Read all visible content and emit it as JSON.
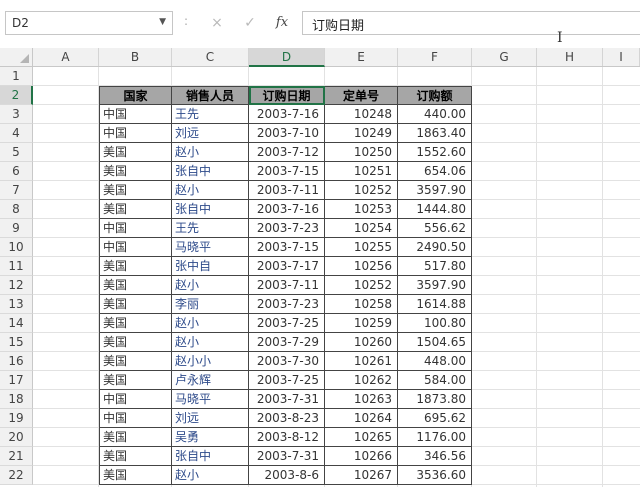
{
  "formula_bar": {
    "name_box": "D2",
    "separator": ":",
    "cancel_icon": "×",
    "enter_icon": "✓",
    "fx_label": "fx",
    "content": "订购日期"
  },
  "cursor": "I",
  "columns": [
    "A",
    "B",
    "C",
    "D",
    "E",
    "F",
    "G",
    "H",
    "I"
  ],
  "rows": [
    "1",
    "2",
    "3",
    "4",
    "5",
    "6",
    "7",
    "8",
    "9",
    "10",
    "11",
    "12",
    "13",
    "14",
    "15",
    "16",
    "17",
    "18",
    "19",
    "20",
    "21",
    "22"
  ],
  "table": {
    "headers": [
      "国家",
      "销售人员",
      "订购日期",
      "定单号",
      "订购额"
    ],
    "rows": [
      [
        "中国",
        "王先",
        "2003-7-16",
        "10248",
        "440.00"
      ],
      [
        "中国",
        "刘远",
        "2003-7-10",
        "10249",
        "1863.40"
      ],
      [
        "美国",
        "赵小",
        "2003-7-12",
        "10250",
        "1552.60"
      ],
      [
        "美国",
        "张自中",
        "2003-7-15",
        "10251",
        "654.06"
      ],
      [
        "美国",
        "赵小",
        "2003-7-11",
        "10252",
        "3597.90"
      ],
      [
        "美国",
        "张自中",
        "2003-7-16",
        "10253",
        "1444.80"
      ],
      [
        "中国",
        "王先",
        "2003-7-23",
        "10254",
        "556.62"
      ],
      [
        "中国",
        "马晓平",
        "2003-7-15",
        "10255",
        "2490.50"
      ],
      [
        "美国",
        "张中自",
        "2003-7-17",
        "10256",
        "517.80"
      ],
      [
        "美国",
        "赵小",
        "2003-7-11",
        "10252",
        "3597.90"
      ],
      [
        "美国",
        "李丽",
        "2003-7-23",
        "10258",
        "1614.88"
      ],
      [
        "美国",
        "赵小",
        "2003-7-25",
        "10259",
        "100.80"
      ],
      [
        "美国",
        "赵小",
        "2003-7-29",
        "10260",
        "1504.65"
      ],
      [
        "美国",
        "赵小小",
        "2003-7-30",
        "10261",
        "448.00"
      ],
      [
        "美国",
        "卢永辉",
        "2003-7-25",
        "10262",
        "584.00"
      ],
      [
        "中国",
        "马晓平",
        "2003-7-31",
        "10263",
        "1873.80"
      ],
      [
        "中国",
        "刘远",
        "2003-8-23",
        "10264",
        "695.62"
      ],
      [
        "美国",
        "吴勇",
        "2003-8-12",
        "10265",
        "1176.00"
      ],
      [
        "美国",
        "张自中",
        "2003-7-31",
        "10266",
        "346.56"
      ],
      [
        "美国",
        "赵小",
        "2003-8-6",
        "10267",
        "3536.60"
      ]
    ]
  },
  "colors": {
    "accent": "#217346",
    "header_fill": "#a6a6a6",
    "name_text": "#2d4a8a"
  }
}
